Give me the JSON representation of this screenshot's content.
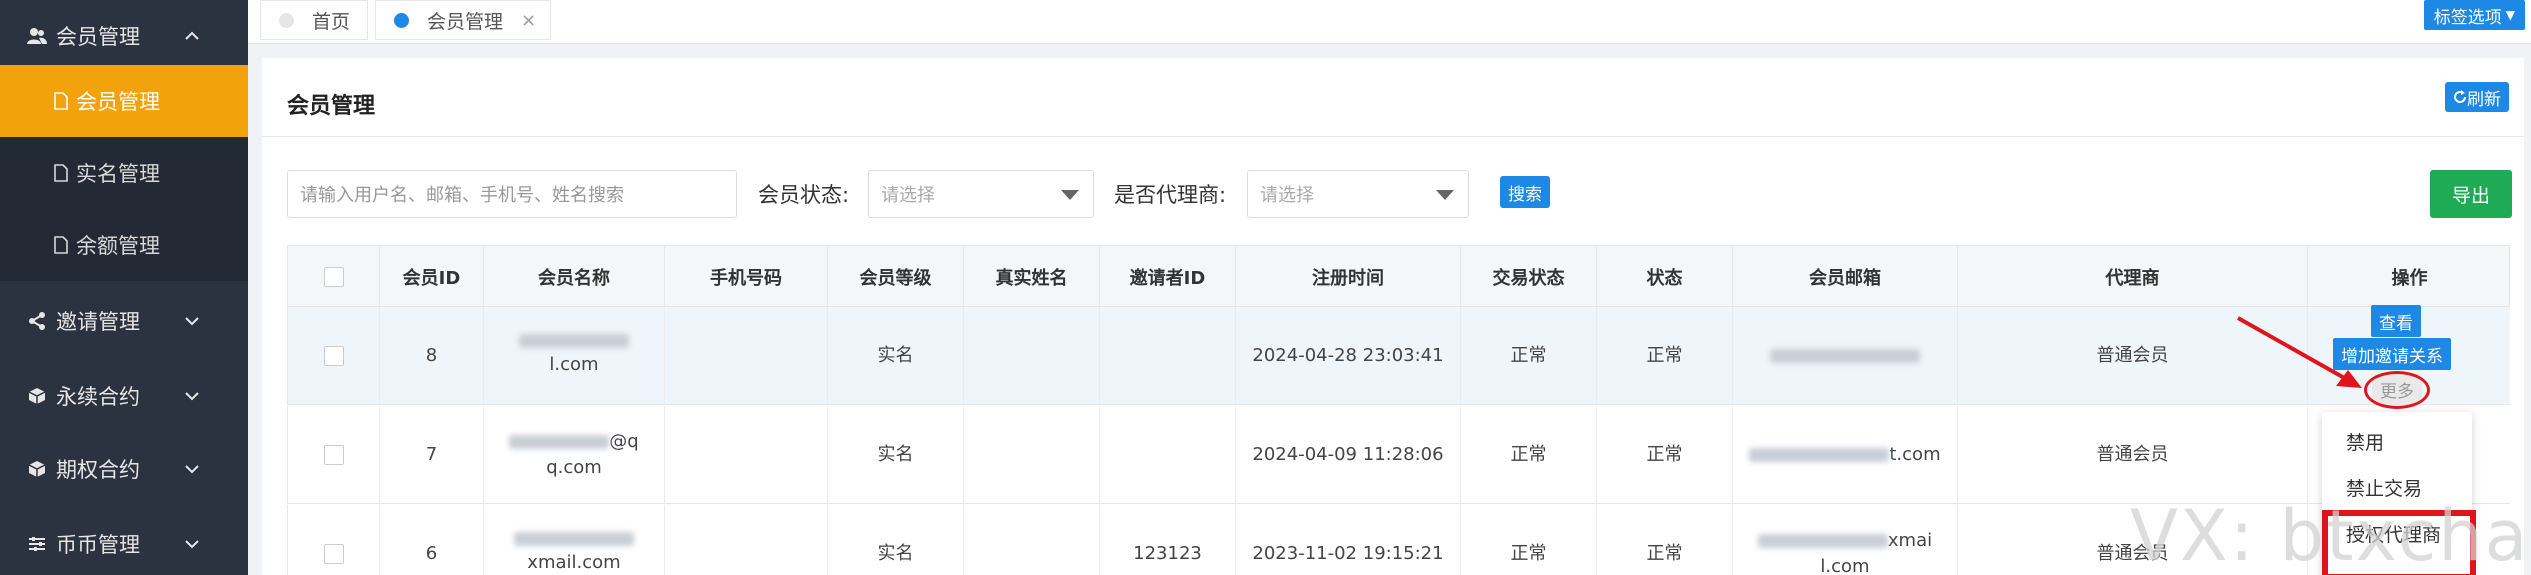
{
  "sidebar": {
    "header": {
      "label": "会员管理",
      "icon": "users-icon"
    },
    "sub_items": [
      {
        "label": "会员管理",
        "active": true
      },
      {
        "label": "实名管理",
        "active": false
      },
      {
        "label": "余额管理",
        "active": false
      }
    ],
    "groups": [
      {
        "label": "邀请管理",
        "icon": "share-icon"
      },
      {
        "label": "永续合约",
        "icon": "cube-icon"
      },
      {
        "label": "期权合约",
        "icon": "cube-icon"
      },
      {
        "label": "币币管理",
        "icon": "sliders-icon"
      }
    ]
  },
  "tabs": [
    {
      "label": "首页",
      "active": false
    },
    {
      "label": "会员管理",
      "active": true
    }
  ],
  "tag_options_label": "标签选项",
  "panel": {
    "title": "会员管理",
    "refresh_label": "刷新",
    "search_placeholder": "请输入用户名、邮箱、手机号、姓名搜索",
    "status_label": "会员状态:",
    "status_placeholder": "请选择",
    "agent_label": "是否代理商:",
    "agent_placeholder": "请选择",
    "search_button": "搜索",
    "export_button": "导出"
  },
  "table": {
    "headers": [
      "会员ID",
      "会员名称",
      "手机号码",
      "会员等级",
      "真实姓名",
      "邀请者ID",
      "注册时间",
      "交易状态",
      "状态",
      "会员邮箱",
      "代理商",
      "操作"
    ],
    "rows": [
      {
        "id": "8",
        "name_tail": "l.com",
        "phone": "",
        "level": "实名",
        "real_name": "",
        "inviter": "",
        "registered": "2024-04-28 23:03:41",
        "trade_status": "正常",
        "status": "正常",
        "email_tail": "",
        "agent": "普通会员"
      },
      {
        "id": "7",
        "name_mid": "@q",
        "name_tail": "q.com",
        "phone": "",
        "level": "实名",
        "real_name": "",
        "inviter": "",
        "registered": "2024-04-09 11:28:06",
        "trade_status": "正常",
        "status": "正常",
        "email_tail": "t.com",
        "agent": "普通会员"
      },
      {
        "id": "6",
        "name_tail": "xmail.com",
        "phone": "",
        "level": "实名",
        "real_name": "",
        "inviter": "123123",
        "registered": "2023-11-02 19:15:21",
        "trade_status": "正常",
        "status": "正常",
        "email_mid": "xmai",
        "email_tail": "l.com",
        "agent": "普通会员"
      }
    ]
  },
  "actions": {
    "view": "查看",
    "add_invite": "增加邀请关系",
    "more": "更多"
  },
  "more_menu": [
    "禁用",
    "禁止交易",
    "授权代理商"
  ],
  "watermark": "VX: btxchain",
  "colors": {
    "sidebar_bg": "#2b3240",
    "active_orange": "#f2a30c",
    "primary_blue": "#1e88e5",
    "export_green": "#1faa55",
    "annotation_red": "#e0151b"
  }
}
